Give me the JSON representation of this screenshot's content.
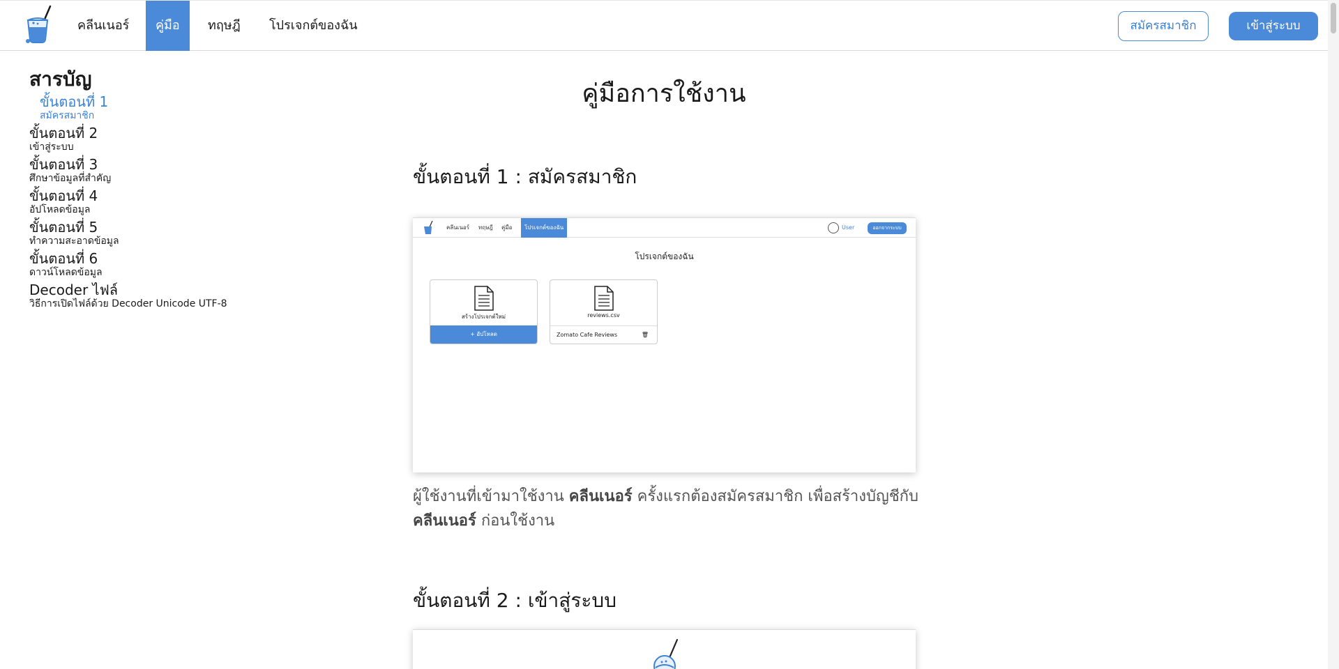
{
  "nav": {
    "items": [
      "คลีนเนอร์",
      "คู่มือ",
      "ทฤษฎี",
      "โปรเจกต์ของฉัน"
    ],
    "active": "คู่มือ",
    "signup_label": "สมัครสมาชิก",
    "login_label": "เข้าสู่ระบบ"
  },
  "toc": {
    "title": "สารบัญ",
    "entries": [
      {
        "step": "ขั้นตอนที่ 1",
        "desc": "สมัครสมาชิก"
      },
      {
        "step": "ขั้นตอนที่ 2",
        "desc": "เข้าสู่ระบบ"
      },
      {
        "step": "ขั้นตอนที่ 3",
        "desc": "ศึกษาข้อมูลที่สำคัญ"
      },
      {
        "step": "ขั้นตอนที่ 4",
        "desc": "อัปโหลดข้อมูล"
      },
      {
        "step": "ขั้นตอนที่ 5",
        "desc": "ทำความสะอาดข้อมูล"
      },
      {
        "step": "ขั้นตอนที่ 6",
        "desc": "ดาวน์โหลดข้อมูล"
      },
      {
        "step": "Decoder ไฟล์",
        "desc": "วิธีการเปิดไฟล์ด้วย Decoder Unicode UTF-8"
      }
    ]
  },
  "main": {
    "title": "คู่มือการใช้งาน",
    "step1_heading": "ขั้นตอนที่ 1 : สมัครสมาชิก",
    "step1_desc": {
      "part1": "ผู้ใช้งานที่เข้ามาใช้งาน ",
      "bold1": "คลีนเนอร์",
      "part2": " ครั้งแรกต้องสมัครสมาชิก เพื่อสร้างบัญชีกับ ",
      "bold2": "คลีนเนอร์",
      "part3": " ก่อนใช้งาน"
    },
    "step2_heading": "ขั้นตอนที่ 2 : เข้าสู่ระบบ"
  },
  "screenshot1": {
    "nav_items": [
      "คลีนเนอร์",
      "ทฤษฎี",
      "คู่มือ",
      "โปรเจกต์ของฉัน"
    ],
    "user_label": "User",
    "logout_label": "ออกจากระบบ",
    "title": "โปรเจกต์ของฉัน",
    "new_project_label": "สร้างโปรเจกต์ใหม่",
    "upload_label": "+ อัปโหลด",
    "file_name": "reviews.csv",
    "project_name": "Zomato Cafe Reviews"
  },
  "colors": {
    "accent": "#4a8ad8"
  }
}
